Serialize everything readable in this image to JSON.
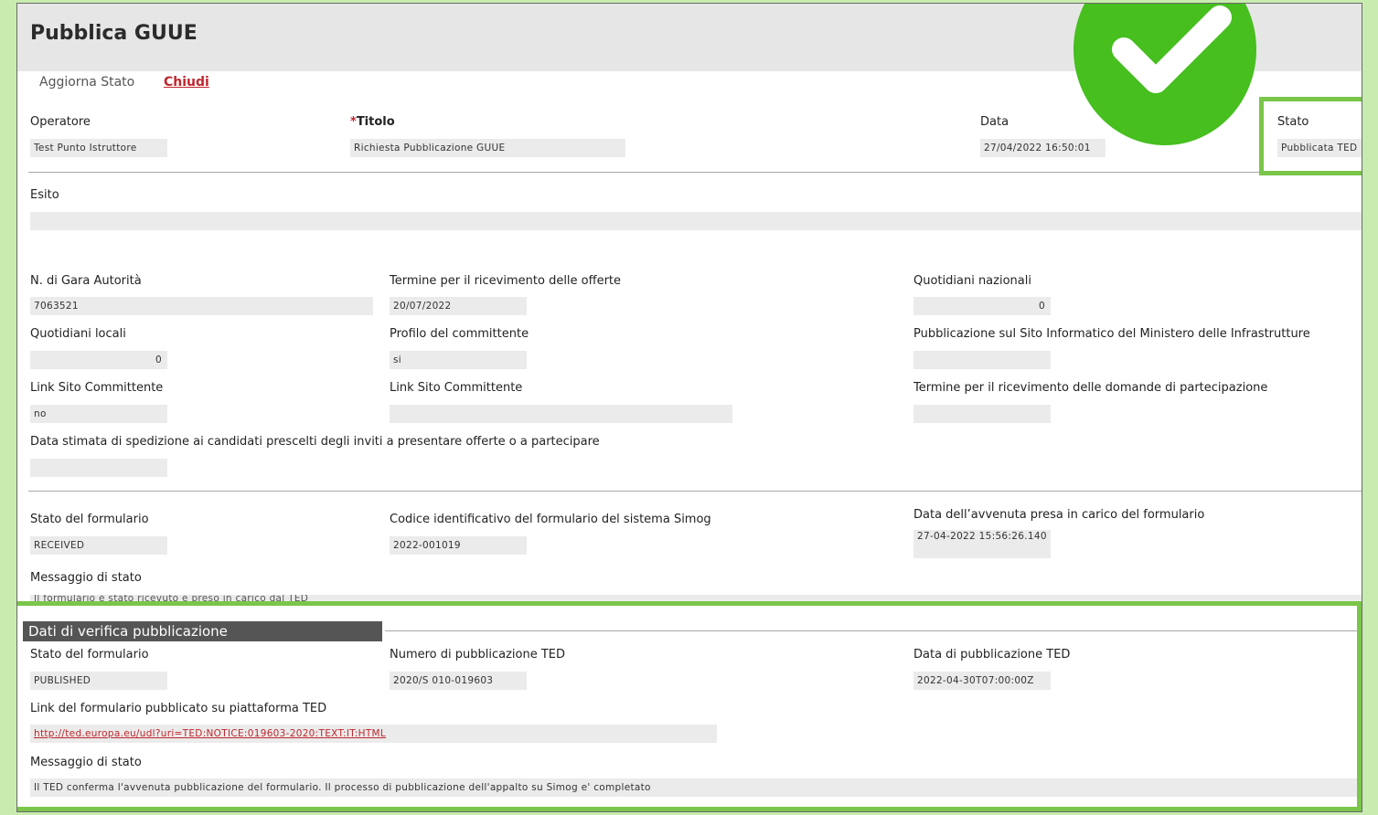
{
  "page": {
    "title": "Pubblica GUUE"
  },
  "toolbar": {
    "aggiorna_label": "Aggiorna Stato",
    "chiudi_label": "Chiudi"
  },
  "header_fields": {
    "operatore_label": "Operatore",
    "operatore_value": "Test Punto Istruttore",
    "titolo_required_mark": "*",
    "titolo_label": "Titolo",
    "titolo_value": "Richiesta Pubblicazione GUUE",
    "data_label": "Data",
    "data_value": "27/04/2022 16:50:01",
    "stato_label": "Stato",
    "stato_value": "Pubblicata TED"
  },
  "esito": {
    "label": "Esito",
    "value": ""
  },
  "gara": {
    "n_gara_label": "N. di Gara Autorità",
    "n_gara_value": "7063521",
    "termine_offerte_label": "Termine per il ricevimento delle offerte",
    "termine_offerte_value": "20/07/2022",
    "quotidiani_nazionali_label": "Quotidiani nazionali",
    "quotidiani_nazionali_value": "0",
    "quotidiani_locali_label": "Quotidiani locali",
    "quotidiani_locali_value": "0",
    "profilo_label": "Profilo del committente",
    "profilo_value": "si",
    "pubblicazione_mit_label": "Pubblicazione sul Sito Informatico del Ministero delle Infrastrutture",
    "pubblicazione_mit_value": "",
    "link_sito_1_label": "Link Sito Committente",
    "link_sito_1_value": "no",
    "link_sito_2_label": "Link Sito Committente",
    "link_sito_2_value": "",
    "termine_domande_label": "Termine per il ricevimento delle domande di partecipazione",
    "termine_domande_value": "",
    "data_stimata_label": "Data stimata di spedizione ai candidati prescelti degli inviti a presentare offerte o a partecipare",
    "data_stimata_value": ""
  },
  "formulario": {
    "stato_label": "Stato del formulario",
    "stato_value": "RECEIVED",
    "codice_label": "Codice identificativo del formulario del sistema Simog",
    "codice_value": "2022-001019",
    "data_presa_label": "Data dell’avvenuta presa in carico del formulario",
    "data_presa_value": "27-04-2022 15:56:26.140",
    "messaggio_label": "Messaggio di stato",
    "messaggio_value": "Il formulario è stato ricevuto e preso in carico dal TED"
  },
  "verifica": {
    "section_title": "Dati di verifica pubblicazione",
    "stato_label": "Stato del formulario",
    "stato_value": "PUBLISHED",
    "numero_label": "Numero di pubblicazione TED",
    "numero_value": "2020/S 010-019603",
    "data_label": "Data di pubblicazione TED",
    "data_value": "2022-04-30T07:00:00Z",
    "link_label": "Link del formulario pubblicato su piattaforma TED",
    "link_value": "http://ted.europa.eu/udl?uri=TED:NOTICE:019603-2020:TEXT:IT:HTML",
    "messaggio_label": "Messaggio di stato",
    "messaggio_value": "Il TED conferma l'avvenuta pubblicazione del formulario. Il processo di pubblicazione dell'appalto su Simog e' completato"
  },
  "overlay": {
    "badge_icon": "check-icon",
    "highlight_color": "#7ac54a",
    "badge_color": "#46bf1f"
  }
}
